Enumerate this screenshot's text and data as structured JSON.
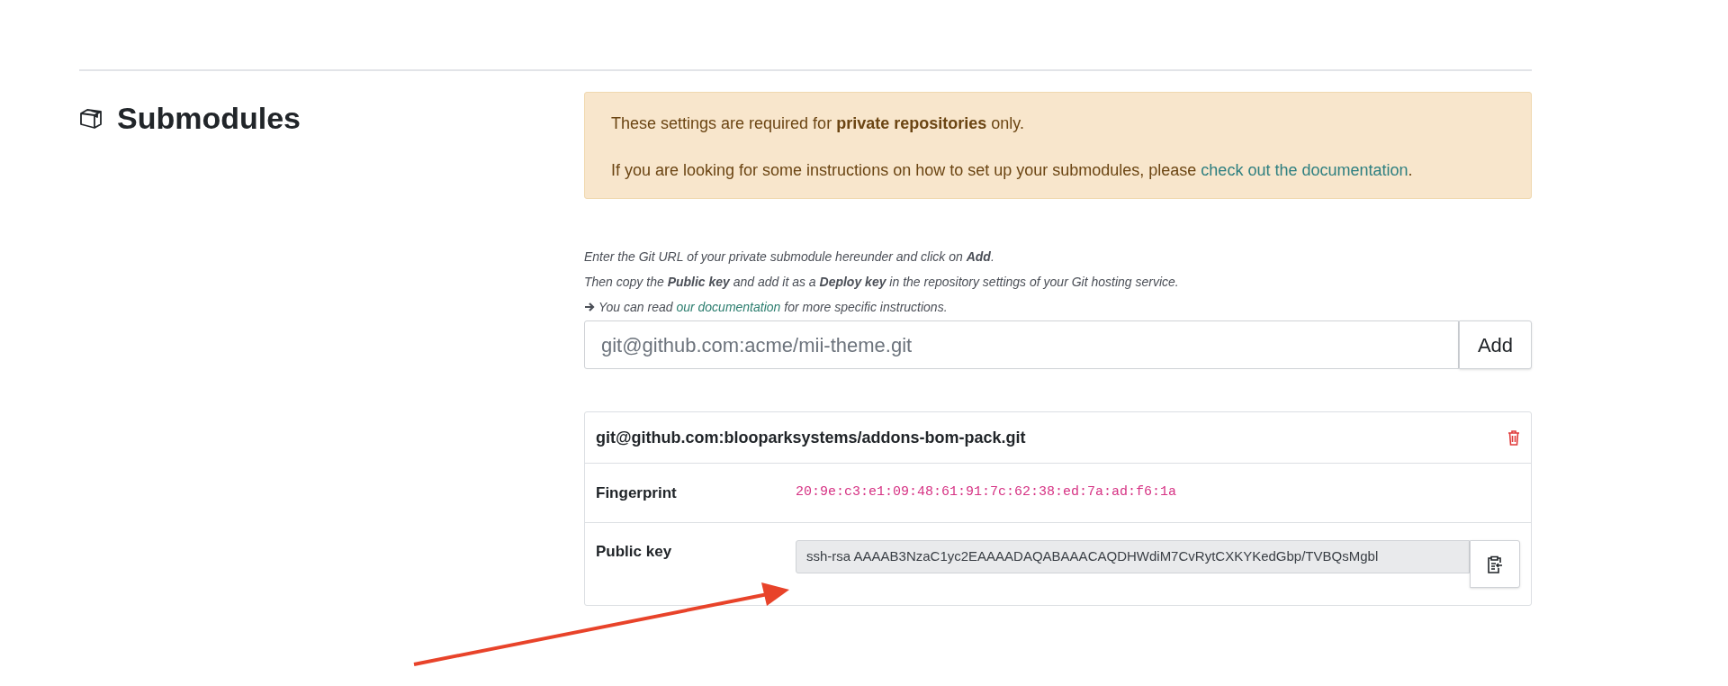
{
  "section": {
    "title": "Submodules"
  },
  "alert": {
    "note": "These settings are required for **private repositories** only.",
    "help": {
      "text": "If you are looking for some instructions on how to set up your submodules, please ",
      "link": "check out the documentation",
      "after": "."
    }
  },
  "instructions": {
    "lines": [
      "Enter the Git URL of your private submodule hereunder and click on **Add**.",
      "Then copy the **Public key** and add it as a **Deploy key** in the repository settings of your Git hosting service."
    ],
    "more": {
      "text": "You can read ",
      "link": "our documentation",
      "after": " for more specific instructions."
    }
  },
  "url_input": {
    "placeholder": "git@github.com:acme/mii-theme.git"
  },
  "add_button": "Add",
  "submodules": [
    {
      "url": "git@github.com:blooparksystems/addons-bom-pack.git",
      "fields": [
        {
          "label": "Fingerprint",
          "kind": "code",
          "value": "20:9e:c3:e1:09:48:61:91:7c:62:38:ed:7a:ad:f6:1a"
        },
        {
          "label": "Public key",
          "kind": "key",
          "value": "ssh-rsa AAAAB3NzaC1yc2EAAAADAQABAAACAQDHWdiM7CvRytCXKYKedGbp/TVBQsMgbl"
        }
      ]
    }
  ]
}
